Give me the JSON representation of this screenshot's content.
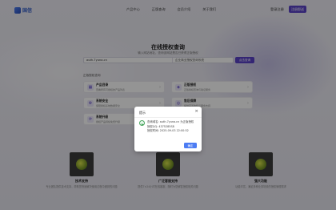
{
  "header": {
    "logo_text": "国信",
    "nav": [
      "产品中心",
      "正版查询",
      "会员介绍",
      "关于我们"
    ],
    "login_label": "登录注册",
    "register_label": "注册即送"
  },
  "hero": {
    "title": "在线授权查询",
    "subtitle": "输入网站地址，查询该网站是否已获得正版授权"
  },
  "search": {
    "value": "auth.7yuna.cn",
    "select_label": "企业商业授权查询系统",
    "button_label": "点击查询"
  },
  "section_label": "正版授权查询",
  "cards": [
    {
      "icon": "grid-icon",
      "glyph": "▦",
      "title": "产品目录",
      "desc": "查看所有可授权的产品列表"
    },
    {
      "icon": "shield-icon",
      "glyph": "◈",
      "title": "正版授权",
      "desc": "正版授权查询与验证服务"
    },
    {
      "icon": "settings-icon",
      "glyph": "⚙",
      "title": "系统安全",
      "desc": "保障授权系统数据安全"
    },
    {
      "icon": "support-icon",
      "glyph": "◎",
      "title": "售后保障",
      "desc": "提供完善的售后服务支持"
    },
    {
      "icon": "update-icon",
      "glyph": "⟳",
      "title": "系统升级",
      "desc": "授权产品持续免费升级"
    }
  ],
  "features": [
    {
      "title": "技术支持",
      "desc": "专业团队提供技术支持，帮助您快速解决使用过程中遇到的问题"
    },
    {
      "title": "广泛客服支持",
      "desc": "提供7×24小时在线客服，随时为您解答授权相关问题"
    },
    {
      "title": "强大功能",
      "desc": "功能丰富，满足多种业务场景的授权管理需求"
    }
  ],
  "modal": {
    "title": "提示",
    "close_glyph": "×",
    "lines": [
      "查询域名: auth.7yuna.cn 为正版授权",
      "授权QQ: 4375285S8",
      "授权时间: 2025-09-03 22:00:52"
    ],
    "ok_label": "确定"
  }
}
